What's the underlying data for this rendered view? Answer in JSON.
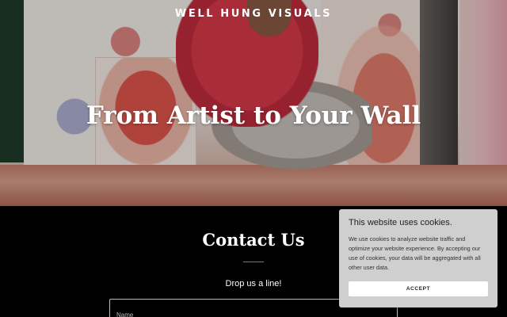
{
  "header": {
    "site_name": "WELL HUNG VISUALS"
  },
  "hero": {
    "title": "From Artist to Your Wall",
    "image": "artist-painting-on-floor"
  },
  "contact": {
    "title": "Contact Us",
    "subtitle": "Drop us a line!",
    "name_placeholder": "Name"
  },
  "cookie_banner": {
    "title": "This website uses cookies.",
    "text": "We use cookies to analyze website traffic and optimize your website experience. By accepting our use of cookies, your data will be aggregated with all other user data.",
    "accept_label": "ACCEPT"
  }
}
